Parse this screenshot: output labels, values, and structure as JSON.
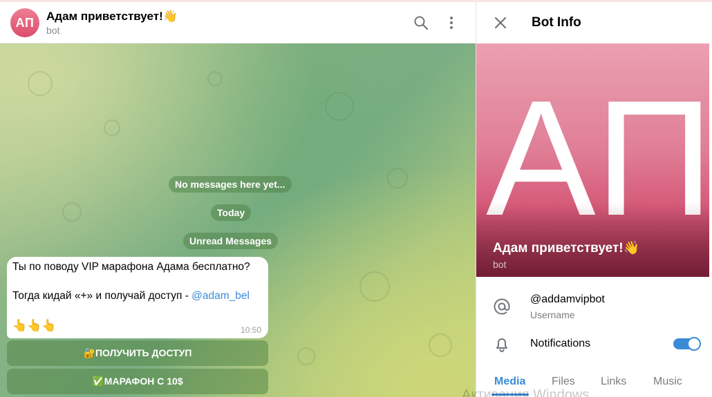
{
  "chat": {
    "avatar_initials": "АП",
    "title": "Адам приветствует!👋",
    "subtitle": "bot",
    "service": {
      "empty": "No messages here yet...",
      "today": "Today",
      "unread": "Unread Messages"
    },
    "message": {
      "line1": "Ты по поводу VIP марафона Адама бесплатно?",
      "line2_text": "Тогда кидай «+» и получай доступ - ",
      "line2_mention": "@adam_bel",
      "line3": "👆👆👆",
      "time": "10:50"
    },
    "keyboard": [
      {
        "label": "🔐ПОЛУЧИТЬ ДОСТУП"
      },
      {
        "label": "✅МАРАФОН С 10$"
      }
    ]
  },
  "info": {
    "title": "Bot Info",
    "avatar_initials": "АП",
    "name": "Адам приветствует!👋",
    "subtitle": "bot",
    "username": "@addamvipbot",
    "username_caption": "Username",
    "notifications_label": "Notifications",
    "notifications_on": true,
    "tabs": [
      {
        "label": "Media",
        "active": true
      },
      {
        "label": "Files",
        "active": false
      },
      {
        "label": "Links",
        "active": false
      },
      {
        "label": "Music",
        "active": false
      }
    ]
  },
  "watermark": "Активация Windows",
  "colors": {
    "accent": "#3a8bd6",
    "avatar_pink": "#e07f97"
  },
  "icons": [
    "search-icon",
    "more-vertical-icon",
    "close-icon",
    "at-sign-icon",
    "bell-icon"
  ]
}
